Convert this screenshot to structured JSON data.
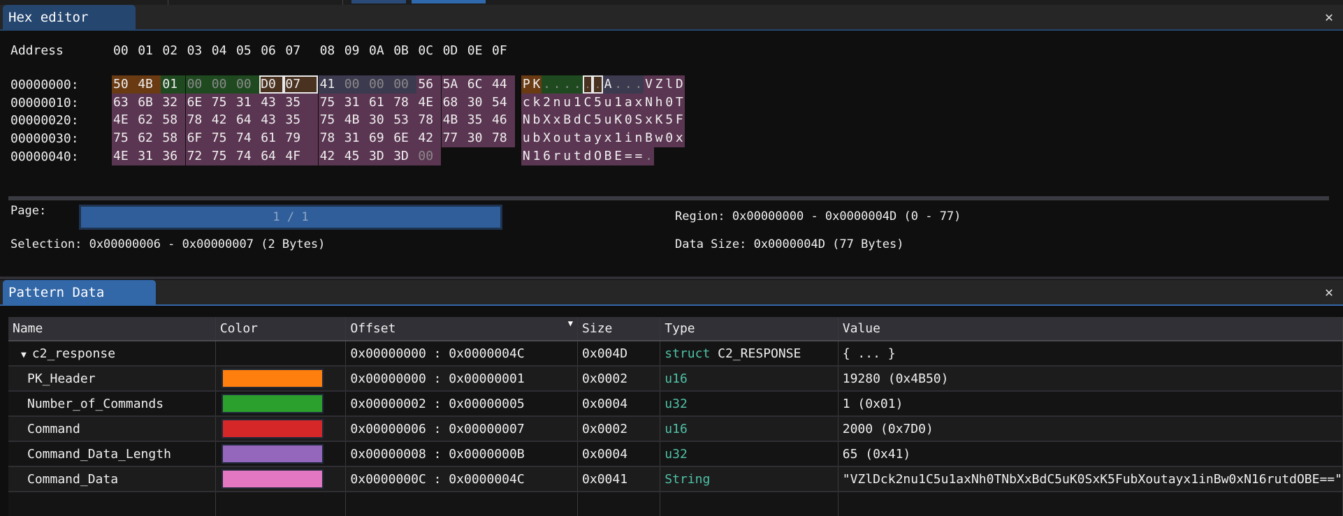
{
  "hex_editor": {
    "title": "Hex editor",
    "close_icon": "close-icon",
    "address_label": "Address",
    "column_headers": [
      "00",
      "01",
      "02",
      "03",
      "04",
      "05",
      "06",
      "07",
      "08",
      "09",
      "0A",
      "0B",
      "0C",
      "0D",
      "0E",
      "0F"
    ],
    "rows": [
      {
        "address": "00000000:",
        "bytes": [
          "50",
          "4B",
          "01",
          "00",
          "00",
          "00",
          "D0",
          "07",
          "41",
          "00",
          "00",
          "00",
          "56",
          "5A",
          "6C",
          "44"
        ],
        "ascii": "PK....․․A...VZlD"
      },
      {
        "address": "00000010:",
        "bytes": [
          "63",
          "6B",
          "32",
          "6E",
          "75",
          "31",
          "43",
          "35",
          "75",
          "31",
          "61",
          "78",
          "4E",
          "68",
          "30",
          "54"
        ],
        "ascii": "ck2nu1C5u1axNh0T"
      },
      {
        "address": "00000020:",
        "bytes": [
          "4E",
          "62",
          "58",
          "78",
          "42",
          "64",
          "43",
          "35",
          "75",
          "4B",
          "30",
          "53",
          "78",
          "4B",
          "35",
          "46"
        ],
        "ascii": "NbXxBdC5uK0SxK5F"
      },
      {
        "address": "00000030:",
        "bytes": [
          "75",
          "62",
          "58",
          "6F",
          "75",
          "74",
          "61",
          "79",
          "78",
          "31",
          "69",
          "6E",
          "42",
          "77",
          "30",
          "78"
        ],
        "ascii": "ubXoutayx1inBw0x"
      },
      {
        "address": "00000040:",
        "bytes": [
          "4E",
          "31",
          "36",
          "72",
          "75",
          "74",
          "64",
          "4F",
          "42",
          "45",
          "3D",
          "3D",
          "00"
        ],
        "ascii": "N16rutdOBE==."
      }
    ],
    "highlight_colors": [
      "#6a3a12",
      "#1f4a20",
      "#4a3220",
      "#3c3a4e",
      "#5b3652"
    ],
    "selection": {
      "start": 6,
      "end": 7
    },
    "page_label": "Page:",
    "page_value": "1 / 1",
    "page_progress": 1.0,
    "selection_text": "Selection: 0x00000006 - 0x00000007 (2 Bytes)",
    "region_text": "Region: 0x00000000 - 0x0000004D (0 - 77)",
    "data_size_text": "Data Size: 0x0000004D (77 Bytes)"
  },
  "pattern_data": {
    "title": "Pattern Data",
    "close_icon": "close-icon",
    "columns": [
      "Name",
      "Color",
      "Offset",
      "Size",
      "Type",
      "Value"
    ],
    "sort_indicator": "▼",
    "rows": [
      {
        "name": "c2_response",
        "expand": "▼",
        "color": "",
        "offset": "0x00000000 : 0x0000004C",
        "size": "0x004D",
        "type_kw": "struct",
        "type_name": "C2_RESPONSE",
        "value": "{ ... }"
      },
      {
        "name": "PK_Header",
        "color": "#ff7f0e",
        "offset": "0x00000000 : 0x00000001",
        "size": "0x0002",
        "type_kw": "u16",
        "type_name": "",
        "value": "19280 (0x4B50)"
      },
      {
        "name": "Number_of_Commands",
        "color": "#2ca02c",
        "offset": "0x00000002 : 0x00000005",
        "size": "0x0004",
        "type_kw": "u32",
        "type_name": "",
        "value": "1 (0x01)"
      },
      {
        "name": "Command",
        "color": "#d62728",
        "offset": "0x00000006 : 0x00000007",
        "size": "0x0002",
        "type_kw": "u16",
        "type_name": "",
        "value": "2000 (0x7D0)"
      },
      {
        "name": "Command_Data_Length",
        "color": "#9467bd",
        "offset": "0x00000008 : 0x0000000B",
        "size": "0x0004",
        "type_kw": "u32",
        "type_name": "",
        "value": "65 (0x41)"
      },
      {
        "name": "Command_Data",
        "color": "#e377c2",
        "offset": "0x0000000C : 0x0000004C",
        "size": "0x0041",
        "type_kw": "String",
        "type_name": "",
        "value": "\"VZlDck2nu1C5u1axNh0TNbXxBdC5uK0SxK5FubXoutayx1inBw0xN16rutdOBE==\""
      }
    ]
  }
}
